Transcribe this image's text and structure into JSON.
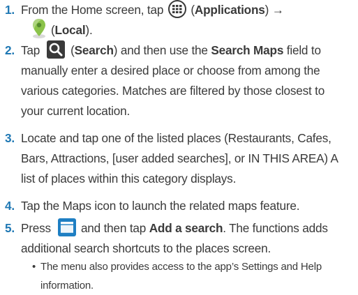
{
  "steps": [
    {
      "number": "1.",
      "p1": "From the Home screen, tap",
      "applications": "Applications",
      "arrow": "→",
      "local": "Local"
    },
    {
      "number": "2.",
      "p1": "Tap",
      "search": "Search",
      "p2": "and then use the",
      "search_maps": "Search Maps",
      "p3": "field to",
      "line2": "manually enter a desired place or choose from among the",
      "line3": "various categories. Matches are filtered by those closest to",
      "line4": "your current location."
    },
    {
      "number": "3.",
      "line1": "Locate and tap one of the listed places (Restaurants, Cafes,",
      "line2": "Bars, Attractions, [user added searches], or IN THIS AREA) A",
      "line3": "list of places within this category displays."
    },
    {
      "number": "4.",
      "line1": "Tap the Maps icon to launch the related maps feature."
    },
    {
      "number": "5.",
      "p1": "Press",
      "p2": "and then tap",
      "add_search": "Add a search",
      "p3": ". The functions adds",
      "line2": "additional search shortcuts to the places screen."
    }
  ],
  "note": {
    "bullet": "•",
    "line1": "The menu also provides access to the app’s Settings and Help",
    "line2": "information."
  },
  "colors": {
    "number": "#1f78b4",
    "text": "#3a3a3a",
    "menu_icon": "#1e7fc3",
    "pin_icon": "#8bc34a"
  },
  "icons": [
    "applications-icon",
    "local-pin-icon",
    "search-icon",
    "menu-icon"
  ]
}
